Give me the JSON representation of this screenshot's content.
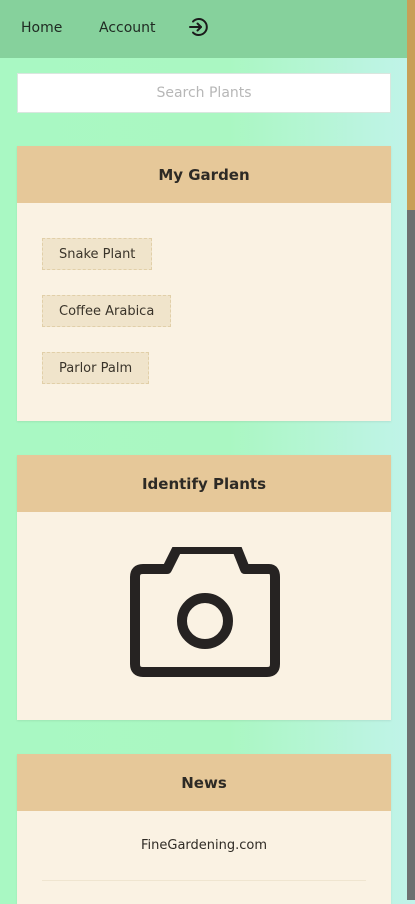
{
  "nav": {
    "home_label": "Home",
    "account_label": "Account",
    "logout_icon": "logout-icon"
  },
  "search": {
    "placeholder": "Search Plants",
    "value": ""
  },
  "garden": {
    "title": "My Garden",
    "plants": [
      "Snake Plant",
      "Coffee Arabica",
      "Parlor Palm"
    ]
  },
  "identify": {
    "title": "Identify Plants",
    "icon": "camera-icon"
  },
  "news": {
    "title": "News",
    "items": [
      "FineGardening.com"
    ]
  },
  "colors": {
    "topbar": "#86d19c",
    "card_header": "#e6c899",
    "card_body": "#faf2e3",
    "scroll_thumb": "#c89f58"
  }
}
